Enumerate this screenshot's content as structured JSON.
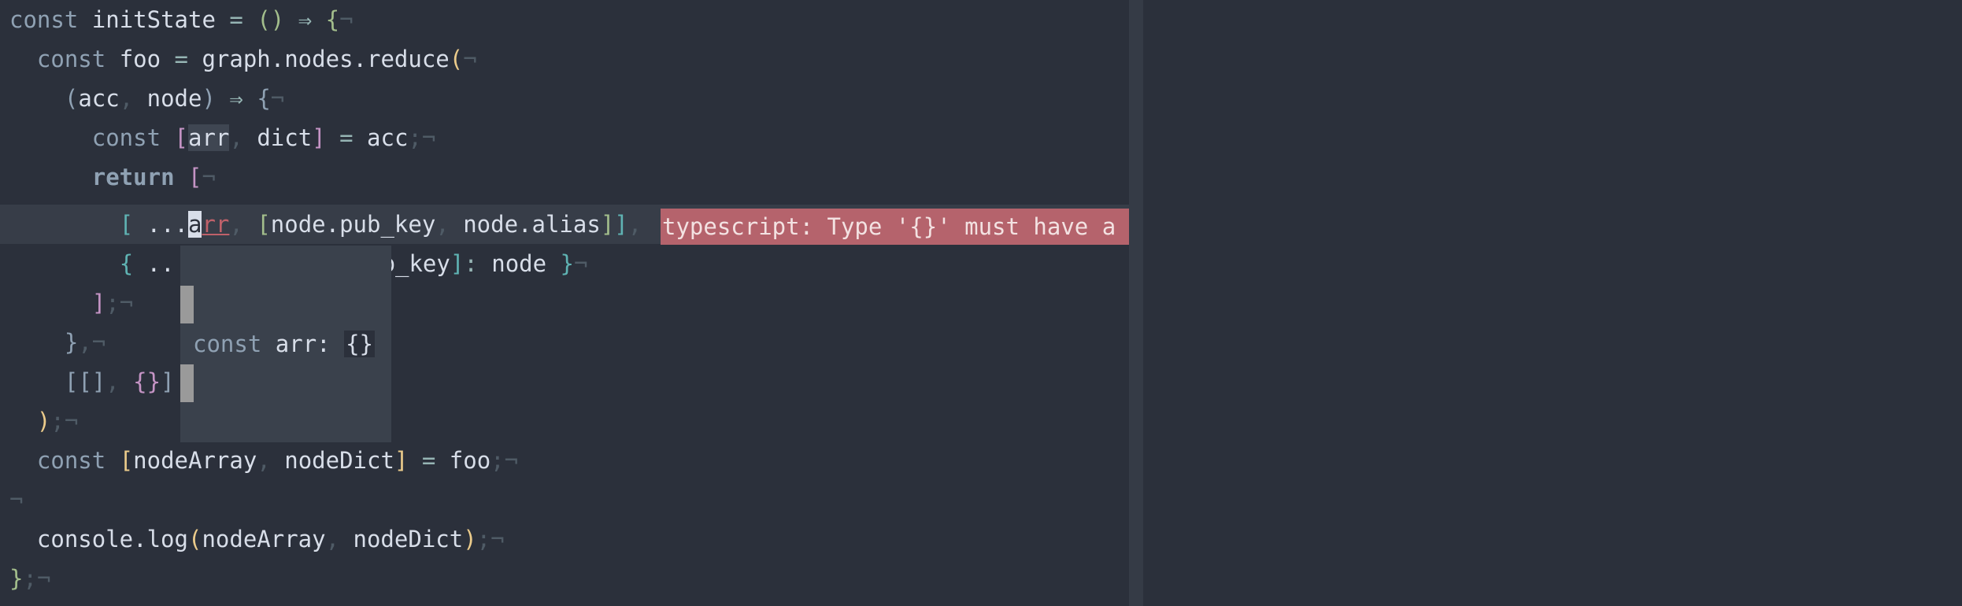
{
  "eol": "¬",
  "lines": [
    {
      "t1": "const",
      "t2": " initState",
      "t3": " = ",
      "t4": "()",
      "t5": " ⇒ ",
      "t6": "{"
    },
    {
      "indent": "  ",
      "t1": "const",
      "t2": " foo",
      "t3": " = ",
      "t4": "graph.nodes.reduce",
      "t5": "("
    },
    {
      "indent": "    ",
      "t1": "(",
      "t2": "acc",
      "t3": ", ",
      "t4": "node",
      "t5": ")",
      "t6": " ⇒ ",
      "t7": "{"
    },
    {
      "indent": "      ",
      "t1": "const",
      "t2": " ",
      "t3": "[",
      "t4": "arr",
      "t5": ", ",
      "t6": "dict",
      "t7": "]",
      "t8": " = ",
      "t9": "acc",
      "t10": ";"
    },
    {
      "indent": "      ",
      "t1": "return",
      "t2": " ",
      "t3": "["
    },
    {
      "indent": "        ",
      "t1": "[",
      "t2": " ...",
      "t3": "a",
      "t4": "rr",
      "t5": ", ",
      "t6": "[",
      "t7": "node.pub_key",
      "t8": ", ",
      "t9": "node.alias",
      "t10": "]",
      "t11": "]",
      "t12": ", "
    },
    {
      "indent": "        ",
      "t1": "{",
      "t2": " ..",
      "t3": "b_key",
      "t4": "]",
      "t5": ": ",
      "t6": "node",
      "t7": " }"
    },
    {
      "indent": "      ",
      "t1": "]",
      "t2": ";"
    },
    {
      "indent": "    ",
      "t1": "}",
      "t2": ","
    },
    {
      "indent": "    ",
      "t1": "[",
      "t2": "[]",
      "t3": ", ",
      "t4": "{}",
      "t5": "]"
    },
    {
      "indent": "  ",
      "t1": ")",
      "t2": ";"
    },
    {
      "indent": "  ",
      "t1": "const",
      "t2": " ",
      "t3": "[",
      "t4": "nodeArray",
      "t5": ", ",
      "t6": "nodeDict",
      "t7": "]",
      "t8": " = ",
      "t9": "foo",
      "t10": ";"
    },
    {},
    {
      "indent": "  ",
      "t1": "console.log",
      "t2": "(",
      "t3": "nodeArray",
      "t4": ", ",
      "t5": "nodeDict",
      "t6": ")",
      "t7": ";"
    },
    {
      "t1": "}",
      "t2": ";"
    }
  ],
  "diagnostic": {
    "message": "typescript: Type '{}' must have a '[Symbol.iterator]()' method that returns an iterator.",
    "severity_color": "#b5636c"
  },
  "hover": {
    "kw": "const",
    "name": " arr: ",
    "type": "{}"
  },
  "theme": {
    "background": "#2b303b",
    "keyword": "#8fa1b3",
    "bracket_yellow": "#ebcb8b",
    "bracket_purple": "#c594c5",
    "bracket_cyan": "#5fb3b3",
    "error": "#bf616a"
  }
}
